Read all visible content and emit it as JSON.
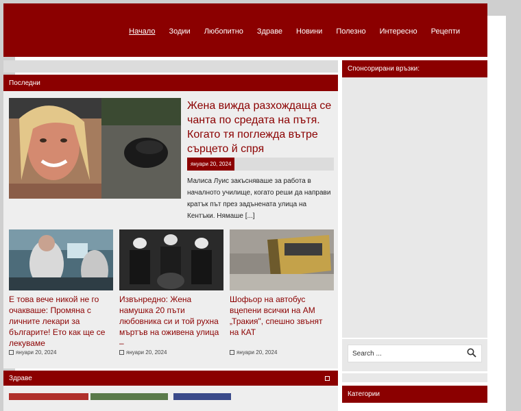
{
  "nav": {
    "items": [
      "Начало",
      "Зодии",
      "Любопитно",
      "Здраве",
      "Новини",
      "Полезно",
      "Интересно",
      "Рецепти"
    ]
  },
  "latest": {
    "title": "Последни",
    "featured": {
      "title": "Жена вижда разхождаща се чанта по средата на пътя. Когато тя поглежда вътре сърцето й спря",
      "date": "януари 20, 2024",
      "excerpt": "Малиса Луис закъсняваше за работа в началното училище, когато реши да направи кратък път през задънената улица на Кентъки. Нямаше [...]"
    },
    "cards": [
      {
        "title": "Е това вече никой не го очакваше: Промяна с личните лекари за българите! Ето как ще се лекуваме",
        "date": "януари 20, 2024"
      },
      {
        "title": "Извънредно: Жена намушка 20 пъти любовника си и той рухна мъртъв на оживена улица –",
        "date": "януари 20, 2024"
      },
      {
        "title": "Шофьор на автобус вцепени всички на АМ „Тракия\", спешно звънят на КАТ",
        "date": "януари 20, 2024"
      }
    ]
  },
  "health": {
    "title": "Здраве"
  },
  "sidebar": {
    "sponsored_title": "Спонсорирани връзки:",
    "search_placeholder": "Search ...",
    "categories_title": "Категории"
  },
  "colors": {
    "brand": "#8b0000",
    "background": "#cfcfcf"
  }
}
